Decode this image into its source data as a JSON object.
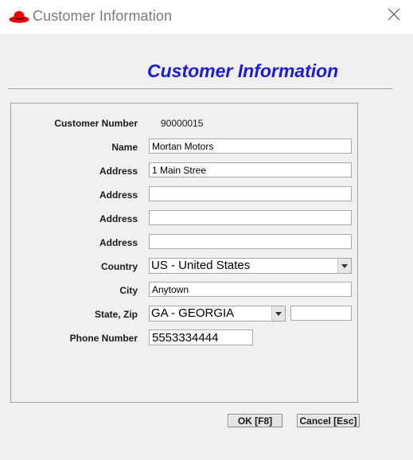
{
  "window": {
    "title": "Customer Information",
    "icon": "red-hat-icon",
    "close_icon": "close-icon"
  },
  "heading": "Customer Information",
  "form": {
    "customer_number_label": "Customer Number",
    "customer_number_value": "90000015",
    "name_label": "Name",
    "name_value": "Mortan Motors",
    "address1_label": "Address",
    "address1_value": "1 Main Stree",
    "address2_label": "Address",
    "address2_value": "",
    "address3_label": "Address",
    "address3_value": "",
    "address4_label": "Address",
    "address4_value": "",
    "country_label": "Country",
    "country_selected": "US - United States",
    "city_label": "City",
    "city_value": "Anytown",
    "state_zip_label": "State, Zip",
    "state_selected": "GA - GEORGIA",
    "zip_value": "",
    "phone_label": "Phone Number",
    "phone_value": "5553334444"
  },
  "buttons": {
    "ok_label": "OK [F8]",
    "cancel_label": "Cancel [Esc]"
  },
  "colors": {
    "heading": "#1a1ae0",
    "icon_red": "#ee0000",
    "background": "#f0f0f0"
  }
}
